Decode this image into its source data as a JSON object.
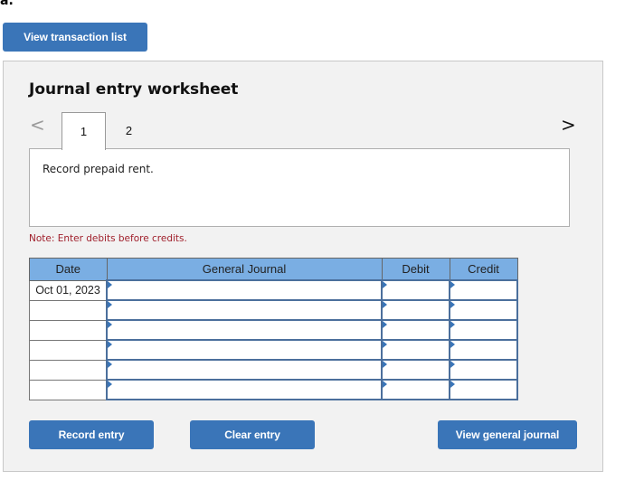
{
  "part_label": "a.",
  "top_button": {
    "label": "View transaction list"
  },
  "worksheet": {
    "title": "Journal entry worksheet",
    "nav": {
      "prev_icon": "chevron-left-icon",
      "next_icon": "chevron-right-icon",
      "prev_glyph": "<",
      "next_glyph": ">"
    },
    "tabs": [
      {
        "label": "1",
        "active": true
      },
      {
        "label": "2",
        "active": false
      }
    ],
    "description": "Record prepaid rent.",
    "note": "Note: Enter debits before credits.",
    "table": {
      "headers": {
        "date": "Date",
        "general_journal": "General Journal",
        "debit": "Debit",
        "credit": "Credit"
      },
      "rows": [
        {
          "date": "Oct 01, 2023",
          "account": "",
          "debit": "",
          "credit": ""
        },
        {
          "date": "",
          "account": "",
          "debit": "",
          "credit": ""
        },
        {
          "date": "",
          "account": "",
          "debit": "",
          "credit": ""
        },
        {
          "date": "",
          "account": "",
          "debit": "",
          "credit": ""
        },
        {
          "date": "",
          "account": "",
          "debit": "",
          "credit": ""
        },
        {
          "date": "",
          "account": "",
          "debit": "",
          "credit": ""
        }
      ]
    },
    "buttons": {
      "record": "Record entry",
      "clear": "Clear entry",
      "view_general_journal": "View general journal"
    }
  },
  "colors": {
    "button_blue": "#3a75b8",
    "header_blue": "#7aaee3",
    "note_red": "#a0202c",
    "panel_bg": "#f2f2f2"
  }
}
